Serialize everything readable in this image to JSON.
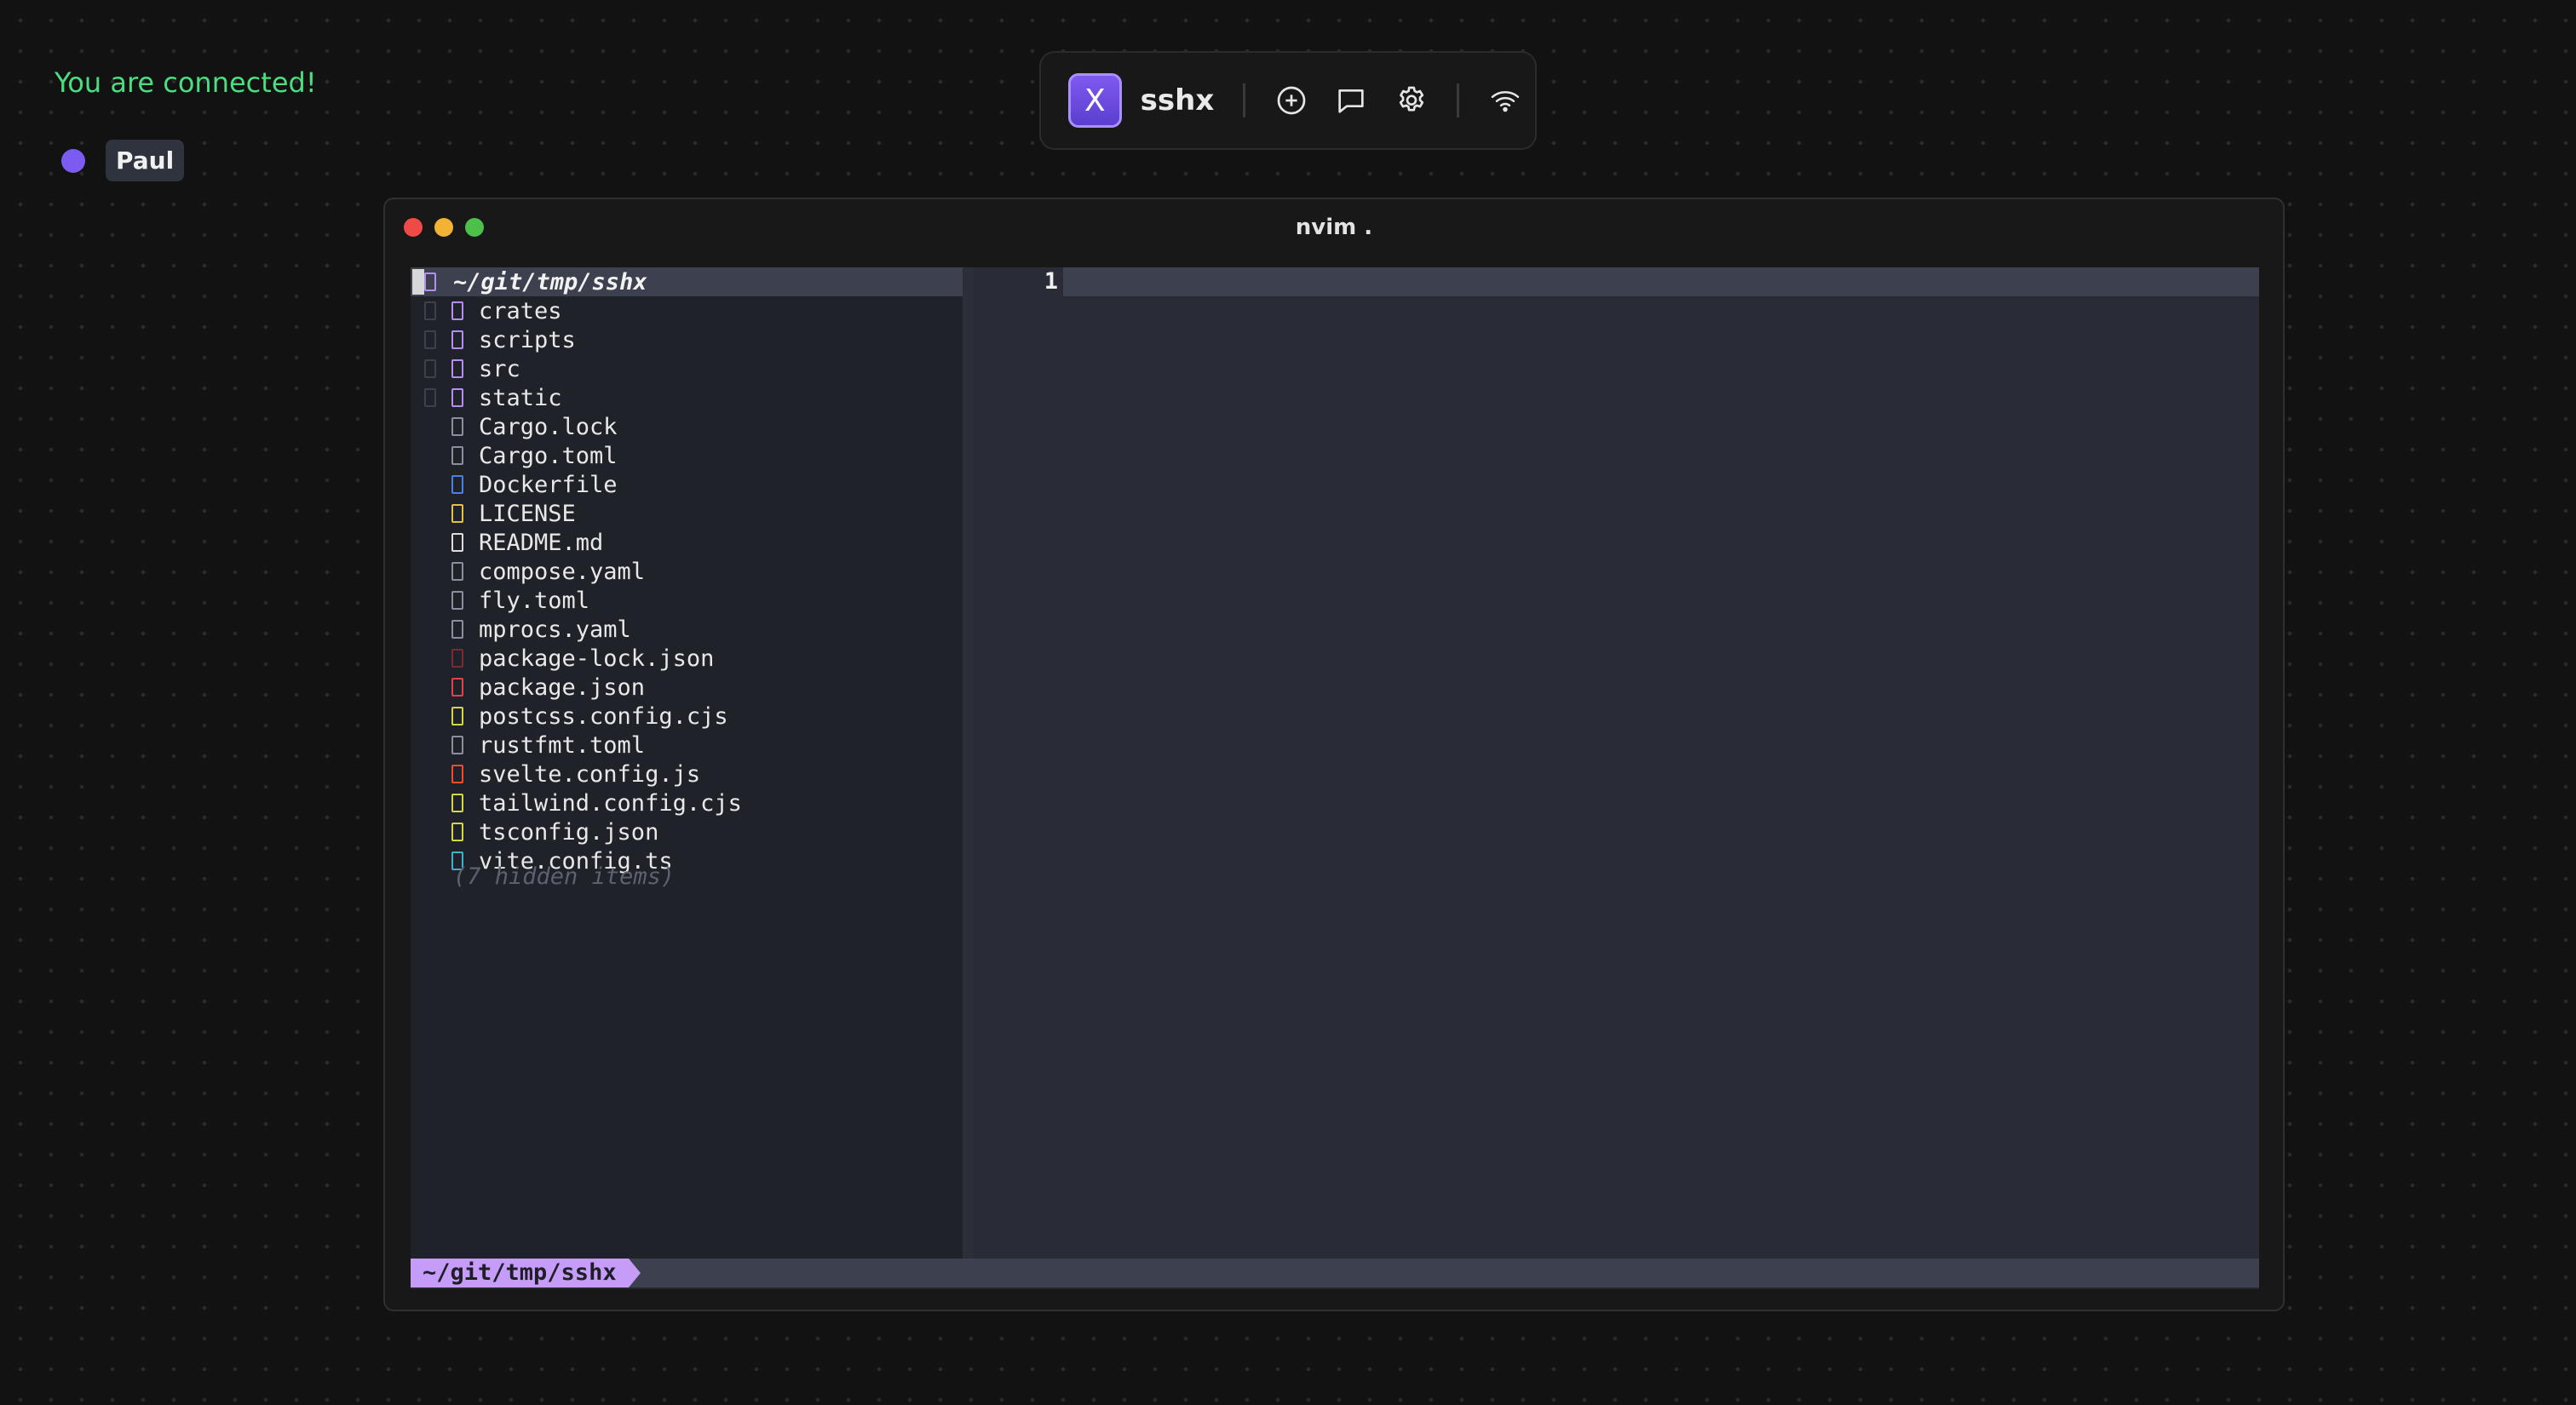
{
  "status": {
    "text": "You are connected!"
  },
  "users": [
    {
      "name": "Paul",
      "color": "#7c5cf0"
    }
  ],
  "toolbar": {
    "logo_letter": "X",
    "app_name": "sshx",
    "buttons": [
      "new-terminal-icon",
      "chat-icon",
      "settings-icon",
      "network-icon"
    ]
  },
  "window": {
    "title": "nvim .",
    "tree": {
      "root": "~/git/tmp/sshx",
      "items": [
        {
          "name": "crates",
          "type": "dir",
          "color": "#b48ef0"
        },
        {
          "name": "scripts",
          "type": "dir",
          "color": "#b48ef0"
        },
        {
          "name": "src",
          "type": "dir",
          "color": "#b48ef0"
        },
        {
          "name": "static",
          "type": "dir",
          "color": "#b48ef0"
        },
        {
          "name": "Cargo.lock",
          "type": "file",
          "color": "#8a8f9e"
        },
        {
          "name": "Cargo.toml",
          "type": "file",
          "color": "#8a8f9e"
        },
        {
          "name": "Dockerfile",
          "type": "file",
          "color": "#4d7fe0"
        },
        {
          "name": "LICENSE",
          "type": "file",
          "color": "#e2c14a"
        },
        {
          "name": "README.md",
          "type": "file",
          "color": "#dcdcdc"
        },
        {
          "name": "compose.yaml",
          "type": "file",
          "color": "#8a8f9e"
        },
        {
          "name": "fly.toml",
          "type": "file",
          "color": "#8a8f9e"
        },
        {
          "name": "mprocs.yaml",
          "type": "file",
          "color": "#8a8f9e"
        },
        {
          "name": "package-lock.json",
          "type": "file",
          "color": "#7a2a33"
        },
        {
          "name": "package.json",
          "type": "file",
          "color": "#e0434b"
        },
        {
          "name": "postcss.config.cjs",
          "type": "file",
          "color": "#d4d648"
        },
        {
          "name": "rustfmt.toml",
          "type": "file",
          "color": "#8a8f9e"
        },
        {
          "name": "svelte.config.js",
          "type": "file",
          "color": "#ef4d2a"
        },
        {
          "name": "tailwind.config.cjs",
          "type": "file",
          "color": "#d4d648"
        },
        {
          "name": "tsconfig.json",
          "type": "file",
          "color": "#d4d648"
        },
        {
          "name": "vite.config.ts",
          "type": "file",
          "color": "#3db3c9"
        }
      ],
      "hidden_note": "(7 hidden items)"
    },
    "editor": {
      "line_number": "1"
    },
    "statusline": {
      "path": "~/git/tmp/sshx"
    }
  }
}
